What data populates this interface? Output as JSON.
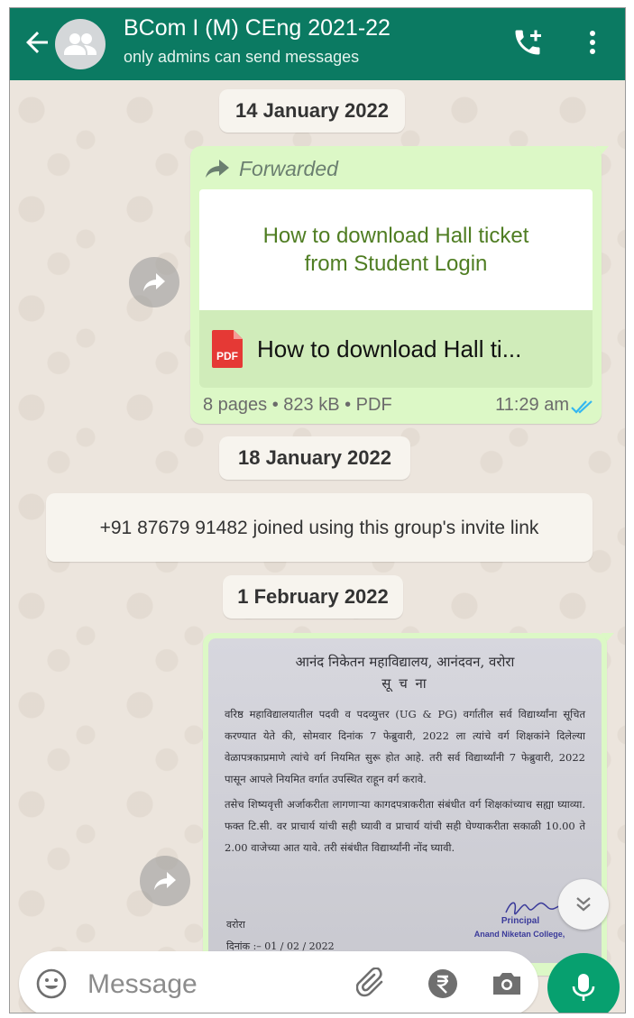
{
  "header": {
    "title": "BCom I (M) CEng 2021-22",
    "subtitle": "only admins can send messages"
  },
  "dates": {
    "first": "14 January 2022",
    "second": "18 January 2022",
    "third": "1 February 2022"
  },
  "doc_message": {
    "forwarded_label": "Forwarded",
    "preview_title": "How to download Hall ticket from Student Login",
    "file_name": "How to download Hall ti...",
    "file_type_badge": "PDF",
    "meta": "8 pages • 823 kB • PDF",
    "time": "11:29 am",
    "status": "read"
  },
  "system_message": "+91 87679 91482 joined using this group's invite link",
  "notice": {
    "heading": "आनंद निकेतन महाविद्यालय, आनंदवन, वरोरा",
    "subheading": "सू च ना",
    "para1": "वरिष्ठ महाविद्यालयातील पदवी व पदव्युत्तर (UG & PG) वर्गातील सर्व विद्यार्थ्यांना सूचित करण्यात येते की, सोमवार दिनांक 7 फेब्रुवारी, 2022 ला त्यांचे वर्ग शिक्षकांने दिलेल्या वेळापत्रकाप्रमाणे त्यांचे वर्ग नियमित सुरू होत आहे. तरी सर्व विद्यार्थ्यांनी 7 फेब्रुवारी, 2022 पासून आपले नियमित वर्गात उपस्थित राहून वर्ग करावे.",
    "para2": "तसेच शिष्यवृत्ती अर्जाकरीता लागणाऱ्या कागदपत्राकरीता संबंधीत वर्ग शिक्षकांच्याच सह्या घ्याव्या. फक्त टि.सी. वर प्राचार्य यांची सही घ्यावी व प्राचार्य यांची सही घेण्याकरीता सकाळी 10.00 ते 2.00 वाजेच्या आत यावे. तरी संबंधीत विद्यार्थ्यांनी नोंद घ्यावी.",
    "place": "वरोरा",
    "date": "दिनांक :– 01 / 02 / 2022",
    "signatory": "Principal",
    "college": "Anand Niketan College,"
  },
  "input": {
    "placeholder": "Message"
  },
  "colors": {
    "header": "#0b7a62",
    "bubble_out": "#dcf8c6",
    "mic_button": "#07a06f",
    "read_ticks": "#34b7f1"
  },
  "icons": [
    "back-arrow-icon",
    "group-avatar-icon",
    "add-call-icon",
    "more-vert-icon",
    "forward-icon",
    "pdf-icon",
    "double-check-icon",
    "share-icon",
    "chevron-double-down-icon",
    "emoji-icon",
    "attach-icon",
    "rupee-icon",
    "camera-icon",
    "mic-icon"
  ]
}
